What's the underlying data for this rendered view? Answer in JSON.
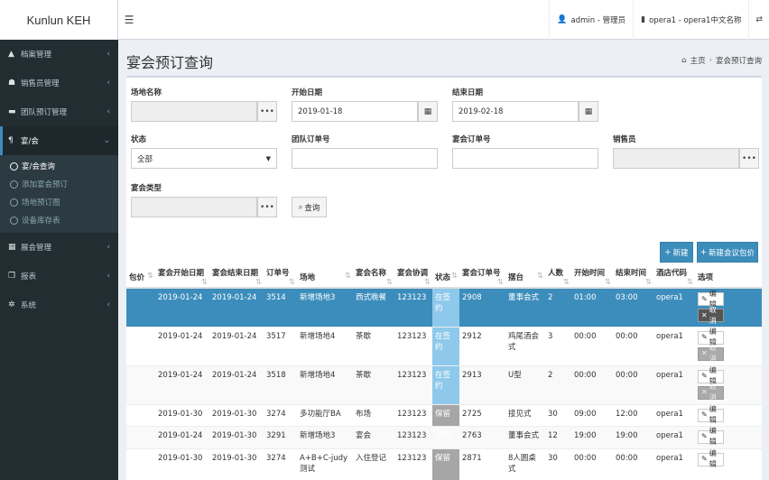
{
  "brand": "Kunlun KEH",
  "topbar": {
    "menu_icon": "bars-icon",
    "user": "admin - 管理员",
    "hotel": "opera1 - opera1中文名称",
    "swap_icon": "exchange-icon"
  },
  "sidebar": {
    "items": [
      {
        "label": "档案管理",
        "icon": "archive-icon"
      },
      {
        "label": "销售员管理",
        "icon": "users-icon"
      },
      {
        "label": "团队预订管理",
        "icon": "bed-icon"
      },
      {
        "label": "宴/会",
        "icon": "utensils-icon"
      },
      {
        "label": "展会管理",
        "icon": "calendar-icon"
      },
      {
        "label": "报表",
        "icon": "copy-icon"
      },
      {
        "label": "系统",
        "icon": "gear-icon"
      }
    ],
    "sub_items": [
      "宴/会查询",
      "添加宴会预订",
      "场地预订图",
      "设备库存表"
    ]
  },
  "page": {
    "title": "宴会预订查询",
    "breadcrumb": [
      "主页",
      "宴会预订查询"
    ]
  },
  "filters": {
    "venue_label": "场地名称",
    "venue_value": "",
    "start_label": "开始日期",
    "start_value": "2019-01-18",
    "end_label": "结束日期",
    "end_value": "2019-02-18",
    "status_label": "状态",
    "status_value": "全部",
    "group_order_label": "团队订单号",
    "group_order_value": "",
    "banquet_order_label": "宴会订单号",
    "banquet_order_value": "",
    "sales_label": "销售员",
    "sales_value": "",
    "type_label": "宴会类型",
    "type_value": "",
    "ellipsis": "•••",
    "search_label": "查询"
  },
  "actions": {
    "new_label": "新建",
    "new_package_label": "新建会议包价"
  },
  "table": {
    "headers": [
      "包价",
      "宴会开始日期",
      "宴会结束日期",
      "订单号",
      "场地",
      "宴会名称",
      "宴会协调",
      "状态",
      "宴会订单号",
      "摆台",
      "人数",
      "开始时间",
      "结束时间",
      "酒店代码",
      "选项"
    ],
    "edit_label": "编辑",
    "cancel_label": "取消",
    "rows": [
      {
        "start": "2019-01-24",
        "end": "2019-01-24",
        "order": "3514",
        "venue": "新增场地3",
        "name": "西式晚餐",
        "coord": "123123",
        "status": "在签约",
        "border": "2908",
        "setup": "董事会式",
        "pax": "2",
        "stime": "01:00",
        "etime": "03:00",
        "hotel": "opera1"
      },
      {
        "start": "2019-01-24",
        "end": "2019-01-24",
        "order": "3517",
        "venue": "新增场地4",
        "name": "茶歇",
        "coord": "123123",
        "status": "在签约",
        "border": "2912",
        "setup": "鸡尾酒会式",
        "pax": "3",
        "stime": "00:00",
        "etime": "00:00",
        "hotel": "opera1"
      },
      {
        "start": "2019-01-24",
        "end": "2019-01-24",
        "order": "3518",
        "venue": "新增场地4",
        "name": "茶歇",
        "coord": "123123",
        "status": "在签约",
        "border": "2913",
        "setup": "U型",
        "pax": "2",
        "stime": "00:00",
        "etime": "00:00",
        "hotel": "opera1"
      },
      {
        "start": "2019-01-30",
        "end": "2019-01-30",
        "order": "3274",
        "venue": "多功能厅BA",
        "name": "布场",
        "coord": "123123",
        "status": "保留",
        "border": "2725",
        "setup": "接见式",
        "pax": "30",
        "stime": "09:00",
        "etime": "12:00",
        "hotel": "opera1"
      },
      {
        "start": "2019-01-24",
        "end": "2019-01-30",
        "order": "3291",
        "venue": "新增场地3",
        "name": "宴会",
        "coord": "123123",
        "status": "保留",
        "border": "2763",
        "setup": "董事会式",
        "pax": "12",
        "stime": "19:00",
        "etime": "19:00",
        "hotel": "opera1"
      },
      {
        "start": "2019-01-30",
        "end": "2019-01-30",
        "order": "3274",
        "venue": "A+B+C-judy测试",
        "name": "入住登记",
        "coord": "123123",
        "status": "保留",
        "border": "2871",
        "setup": "8人圆桌式",
        "pax": "30",
        "stime": "00:00",
        "etime": "00:00",
        "hotel": "opera1"
      }
    ]
  }
}
